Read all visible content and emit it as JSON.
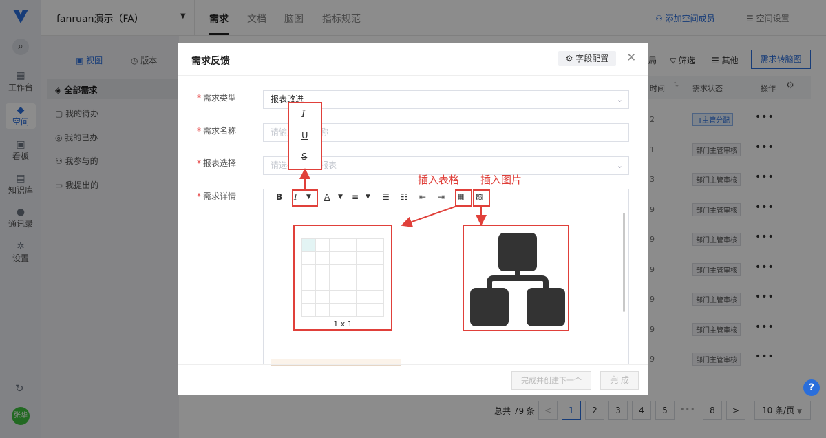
{
  "nav": {
    "items": [
      {
        "label": "工作台",
        "icon": "grid-icon"
      },
      {
        "label": "空间",
        "icon": "cube-icon"
      },
      {
        "label": "看板",
        "icon": "board-icon"
      },
      {
        "label": "知识库",
        "icon": "book-icon"
      },
      {
        "label": "通讯录",
        "icon": "contacts-icon"
      },
      {
        "label": "设置",
        "icon": "gear-icon"
      }
    ],
    "avatar": "张华"
  },
  "topbar": {
    "workspace": "fanruan演示（FA）",
    "tabs": [
      "需求",
      "文档",
      "脑图",
      "指标规范"
    ],
    "add_member": "添加空间成员",
    "settings": "空间设置"
  },
  "sidebar": {
    "view": "视图",
    "version": "版本",
    "items": [
      "全部需求",
      "我的待办",
      "我的已办",
      "我参与的",
      "我提出的"
    ]
  },
  "toolbar": {
    "partial": "局",
    "filter": "筛选",
    "other": "其他",
    "convert": "需求转脑图"
  },
  "table": {
    "col_time": "时间",
    "col_status": "需求状态",
    "col_ops": "操作",
    "rows": [
      {
        "num": "2",
        "status": "IT主管分配"
      },
      {
        "num": "1",
        "status": "部门主管审核"
      },
      {
        "num": "3",
        "status": "部门主管审核"
      },
      {
        "num": "9",
        "status": "部门主管审核"
      },
      {
        "num": "9",
        "status": "部门主管审核"
      },
      {
        "num": "9",
        "status": "部门主管审核"
      },
      {
        "num": "9",
        "status": "部门主管审核"
      },
      {
        "num": "9",
        "status": "部门主管审核"
      },
      {
        "num": "9",
        "status": "部门主管审核"
      }
    ],
    "more": "•••"
  },
  "pagination": {
    "total": "总共 79 条",
    "pages": [
      "1",
      "2",
      "3",
      "4",
      "5",
      "8"
    ],
    "ellipsis": "•••",
    "per_page": "10 条/页"
  },
  "help": "?",
  "modal": {
    "title": "需求反馈",
    "field_config": "字段配置",
    "fields": {
      "type_label": "需求类型",
      "type_value": "报表改进",
      "name_label": "需求名称",
      "name_placeholder": "请输入需求名称",
      "report_label": "报表选择",
      "report_placeholder": "请选择或搜索报表",
      "detail_label": "需求详情"
    },
    "format_menu": [
      "I",
      "U",
      "S"
    ],
    "grid_size": "1 x 1",
    "btn_next": "完成并创建下一个",
    "btn_done": "完 成"
  },
  "annotations": {
    "table": "插入表格",
    "image": "插入图片"
  },
  "colors": {
    "accent": "#2a6edb",
    "annotation": "#e0403a"
  }
}
